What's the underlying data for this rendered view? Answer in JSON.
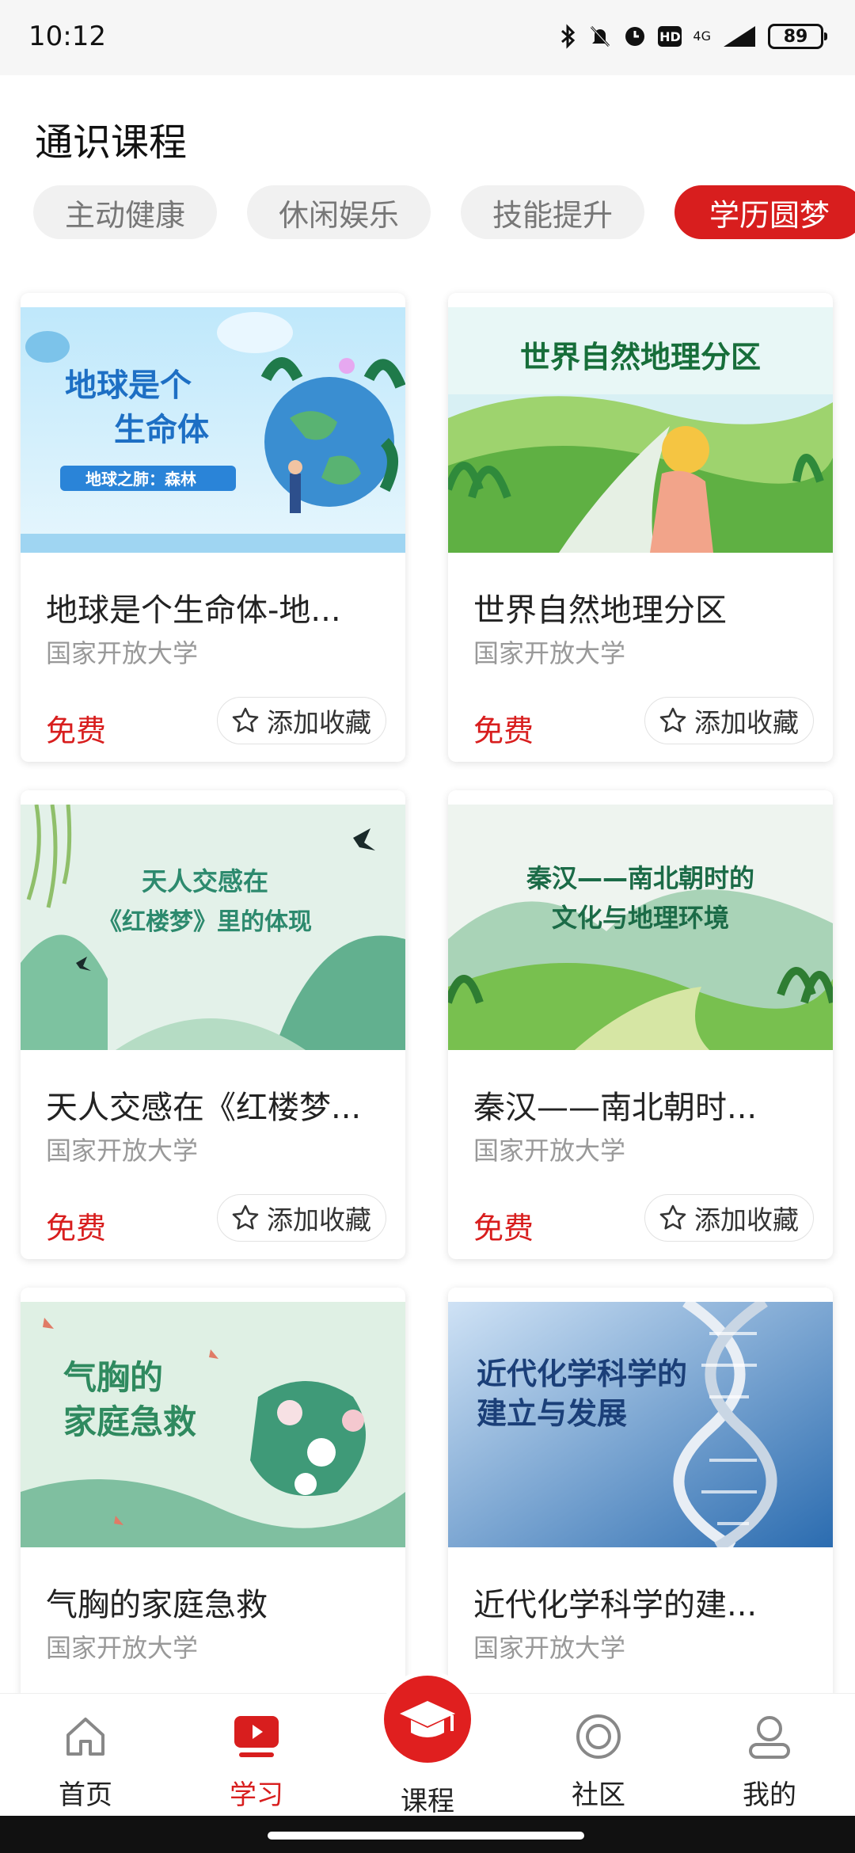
{
  "status": {
    "time": "10:12",
    "battery": "89",
    "network": "4G",
    "hd": "HD"
  },
  "header": {
    "title": "通识课程"
  },
  "tabs": [
    {
      "label": "主动健康",
      "active": false
    },
    {
      "label": "休闲娱乐",
      "active": false
    },
    {
      "label": "技能提升",
      "active": false
    },
    {
      "label": "学历圆梦",
      "active": true
    }
  ],
  "courses": [
    {
      "title": "地球是个生命体-地...",
      "provider": "国家开放大学",
      "price": "免费",
      "fav_label": "添加收藏",
      "cover_line1": "地球是个",
      "cover_line2": "生命体",
      "cover_tag": "地球之肺：森林"
    },
    {
      "title": "世界自然地理分区",
      "provider": "国家开放大学",
      "price": "免费",
      "fav_label": "添加收藏",
      "cover_line1": "世界自然地理分区"
    },
    {
      "title": "天人交感在《红楼梦...",
      "provider": "国家开放大学",
      "price": "免费",
      "fav_label": "添加收藏",
      "cover_line1": "天人交感在",
      "cover_line2": "《红楼梦》里的体现"
    },
    {
      "title": "秦汉——南北朝时...",
      "provider": "国家开放大学",
      "price": "免费",
      "fav_label": "添加收藏",
      "cover_line1": "秦汉——南北朝时的",
      "cover_line2": "文化与地理环境"
    },
    {
      "title": "气胸的家庭急救",
      "provider": "国家开放大学",
      "cover_line1": "气胸的",
      "cover_line2": "家庭急救"
    },
    {
      "title": "近代化学科学的建...",
      "provider": "国家开放大学",
      "cover_line1": "近代化学科学的",
      "cover_line2": "建立与发展"
    }
  ],
  "nav": [
    {
      "label": "首页",
      "icon": "home-icon",
      "active": false
    },
    {
      "label": "学习",
      "icon": "play-icon",
      "active": true
    },
    {
      "label": "课程",
      "icon": "graduation-cap-icon",
      "active": false
    },
    {
      "label": "社区",
      "icon": "circle-target-icon",
      "active": false
    },
    {
      "label": "我的",
      "icon": "user-icon",
      "active": false
    }
  ],
  "colors": {
    "accent": "#d81e1e",
    "tab_bg": "#f1f1f1",
    "muted_text": "#999999"
  }
}
